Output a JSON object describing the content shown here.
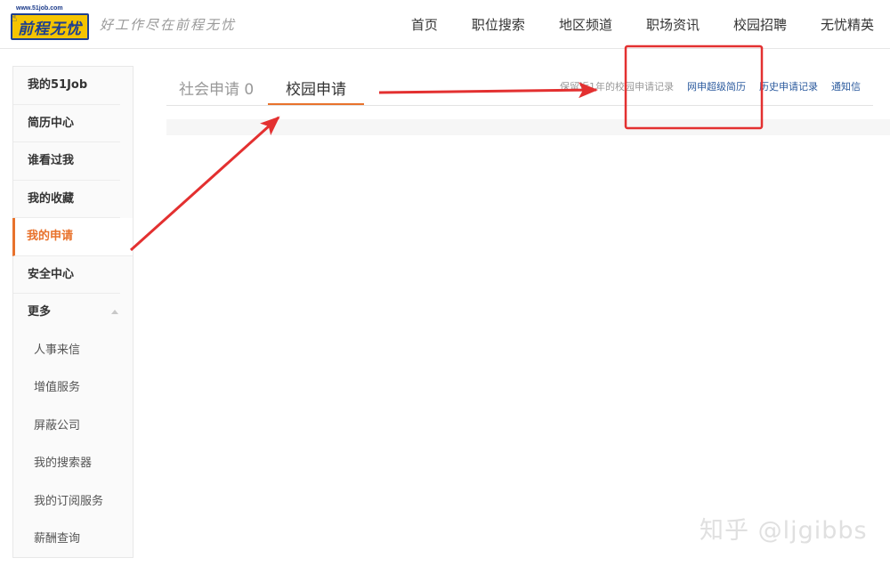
{
  "logo": {
    "url": "www.51job.com",
    "text": "前程无忧"
  },
  "slogan": "好工作尽在前程无忧",
  "nav": [
    "首页",
    "职位搜索",
    "地区频道",
    "职场资讯",
    "校园招聘",
    "无忧精英"
  ],
  "sidebar": {
    "items": [
      "我的51Job",
      "简历中心",
      "谁看过我",
      "我的收藏",
      "我的申请",
      "安全中心",
      "更多"
    ],
    "active": "我的申请",
    "sub_items": [
      "人事来信",
      "增值服务",
      "屏蔽公司",
      "我的搜索器",
      "我的订阅服务",
      "薪酬查询"
    ]
  },
  "tabs": {
    "social": "社会申请 0",
    "campus": "校园申请"
  },
  "links": {
    "hint": "保留近1年的校园申请记录",
    "super_resume": "网申超级简历",
    "history": "历史申请记录",
    "notice": "通知信"
  },
  "watermark": "知乎 @ljgibbs",
  "colors": {
    "accent": "#e8722c",
    "link": "#2c5b9e",
    "annotation": "#e33030"
  }
}
